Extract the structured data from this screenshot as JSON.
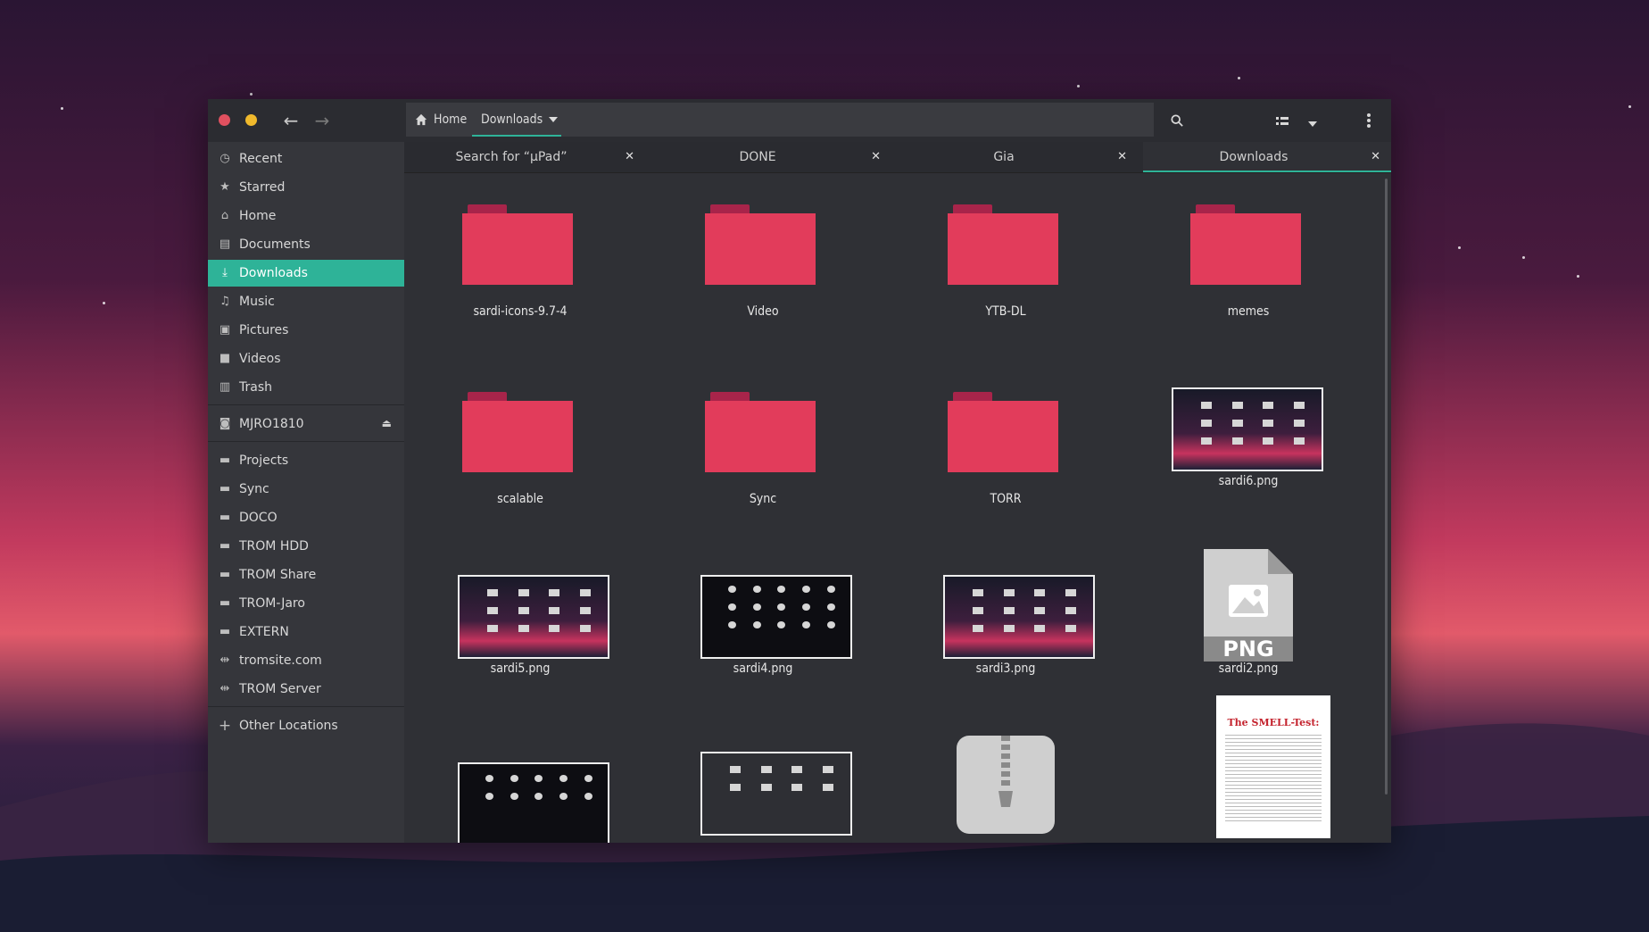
{
  "navigation": {
    "back_icon": "arrow-left-icon",
    "forward_icon": "arrow-right-icon"
  },
  "pathbar": {
    "home_label": "Home",
    "current_label": "Downloads"
  },
  "sidebar": {
    "places": [
      {
        "label": "Recent",
        "icon": "clock-icon"
      },
      {
        "label": "Starred",
        "icon": "star-icon"
      },
      {
        "label": "Home",
        "icon": "home-icon"
      },
      {
        "label": "Documents",
        "icon": "document-icon"
      },
      {
        "label": "Downloads",
        "icon": "download-icon",
        "selected": true
      },
      {
        "label": "Music",
        "icon": "music-icon"
      },
      {
        "label": "Pictures",
        "icon": "picture-icon"
      },
      {
        "label": "Videos",
        "icon": "video-icon"
      },
      {
        "label": "Trash",
        "icon": "trash-icon"
      }
    ],
    "devices": [
      {
        "label": "MJRO1810",
        "icon": "drive-icon"
      }
    ],
    "bookmarks": [
      {
        "label": "Projects",
        "icon": "folder-icon"
      },
      {
        "label": "Sync",
        "icon": "folder-icon"
      },
      {
        "label": "DOCO",
        "icon": "folder-icon"
      },
      {
        "label": "TROM HDD",
        "icon": "folder-icon"
      },
      {
        "label": "TROM Share",
        "icon": "folder-icon"
      },
      {
        "label": "TROM-Jaro",
        "icon": "folder-icon"
      },
      {
        "label": "EXTERN",
        "icon": "folder-icon"
      },
      {
        "label": "tromsite.com",
        "icon": "network-icon"
      },
      {
        "label": "TROM Server",
        "icon": "network-icon"
      }
    ],
    "other_locations": "Other Locations"
  },
  "tabs": [
    {
      "label": "Search for “µPad”"
    },
    {
      "label": "DONE"
    },
    {
      "label": "Gia"
    },
    {
      "label": "Downloads",
      "active": true
    }
  ],
  "files": [
    {
      "name": "sardi-icons-9.7-4",
      "kind": "folder"
    },
    {
      "name": "Video",
      "kind": "folder"
    },
    {
      "name": "YTB-DL",
      "kind": "folder"
    },
    {
      "name": "memes",
      "kind": "folder"
    },
    {
      "name": "scalable",
      "kind": "folder"
    },
    {
      "name": "Sync",
      "kind": "folder"
    },
    {
      "name": "TORR",
      "kind": "folder"
    },
    {
      "name": "sardi6.png",
      "kind": "image"
    },
    {
      "name": "sardi5.png",
      "kind": "image"
    },
    {
      "name": "sardi4.png",
      "kind": "image"
    },
    {
      "name": "sardi3.png",
      "kind": "image"
    },
    {
      "name": "sardi2.png",
      "kind": "png-generic"
    }
  ],
  "png_badge": "PNG",
  "document_title": "The SMELL-Test:",
  "colors": {
    "accent": "#2eb398",
    "folder": "#e23c5b",
    "close_dot": "#e0505f",
    "minimize_dot": "#f0b92c"
  }
}
